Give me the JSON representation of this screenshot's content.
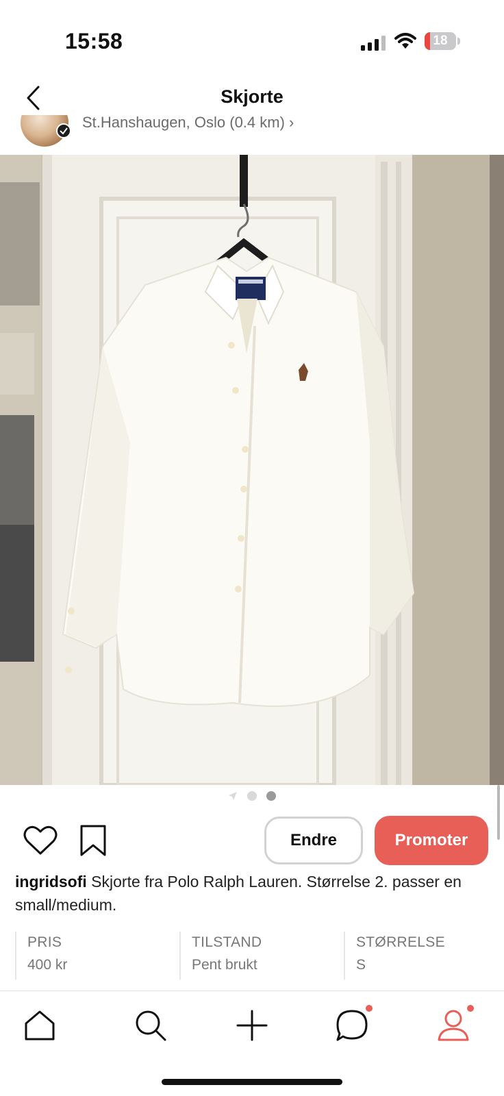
{
  "status_bar": {
    "time": "15:58",
    "battery": "18",
    "battery_level": 0.18,
    "battery_color": "#e8463f"
  },
  "header": {
    "title": "Skjorte",
    "back_icon": "chevron-left-icon"
  },
  "seller": {
    "location": "St.Hanshaugen, Oslo (0.4 km) ›"
  },
  "gallery": {
    "image_count": 2,
    "active_index": 1
  },
  "actions": {
    "like_icon": "heart-icon",
    "save_icon": "bookmark-icon",
    "edit_label": "Endre",
    "promote_label": "Promoter",
    "promote_color": "#e85f58"
  },
  "listing": {
    "username": "ingridsofi",
    "description": "Skjorte fra Polo Ralph Lauren. Størrelse 2. passer en small/medium."
  },
  "details": [
    {
      "label": "PRIS",
      "value": "400 kr"
    },
    {
      "label": "TILSTAND",
      "value": "Pent brukt"
    },
    {
      "label": "STØRRELSE",
      "value": "S"
    }
  ],
  "tabbar": {
    "items": [
      {
        "name": "home",
        "icon": "home-icon",
        "badge": false
      },
      {
        "name": "search",
        "icon": "search-icon",
        "badge": false
      },
      {
        "name": "add",
        "icon": "plus-icon",
        "badge": false
      },
      {
        "name": "messages",
        "icon": "chat-bubble-icon",
        "badge": true
      },
      {
        "name": "profile",
        "icon": "profile-icon",
        "badge": true,
        "active": true
      }
    ],
    "active_color": "#e85f58"
  }
}
